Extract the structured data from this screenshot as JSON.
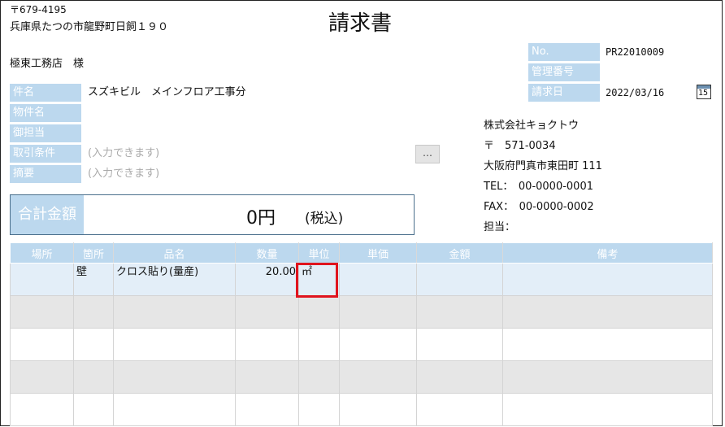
{
  "sender_address": {
    "postal": "〒679-4195",
    "address": "兵庫県たつの市龍野町日飼１９０"
  },
  "title": "請求書",
  "recipient": "極東工務店　様",
  "left_fields": [
    {
      "label": "件名",
      "value": "スズキビル　メインフロア工事分",
      "placeholder": ""
    },
    {
      "label": "物件名",
      "value": "",
      "placeholder": ""
    },
    {
      "label": "御担当",
      "value": "",
      "placeholder": ""
    },
    {
      "label": "取引条件",
      "value": "",
      "placeholder": "(入力できます)"
    },
    {
      "label": "摘要",
      "value": "",
      "placeholder": "(入力できます)"
    }
  ],
  "dots_button": "…",
  "right_fields": [
    {
      "label": "No.",
      "value": "PR22010009"
    },
    {
      "label": "管理番号",
      "value": ""
    },
    {
      "label": "請求日",
      "value": "2022/03/16"
    }
  ],
  "calendar_day": "15",
  "company": {
    "name": "株式会社キョクトウ",
    "postal": "〒　571-0034",
    "address": "大阪府門真市東田町 111",
    "tel": "TEL：　00-0000-0001",
    "fax": "FAX：　00-0000-0002",
    "person": "担当："
  },
  "total": {
    "label": "合計金額",
    "amount": "0円",
    "tax_note": "(税込)"
  },
  "table": {
    "headers": [
      "場所",
      "箇所",
      "品名",
      "数量",
      "単位",
      "単価",
      "金額",
      "備考"
    ],
    "rows": [
      [
        "",
        "壁",
        "クロス貼り(量産)",
        "20.00",
        "㎡",
        "",
        "",
        ""
      ],
      [
        "",
        "",
        "",
        "",
        "",
        "",
        "",
        ""
      ],
      [
        "",
        "",
        "",
        "",
        "",
        "",
        "",
        ""
      ],
      [
        "",
        "",
        "",
        "",
        "",
        "",
        "",
        ""
      ],
      [
        "",
        "",
        "",
        "",
        "",
        "",
        "",
        ""
      ]
    ]
  },
  "colors": {
    "label_bg": "#bcd8ee",
    "highlight": "#e0141e"
  }
}
